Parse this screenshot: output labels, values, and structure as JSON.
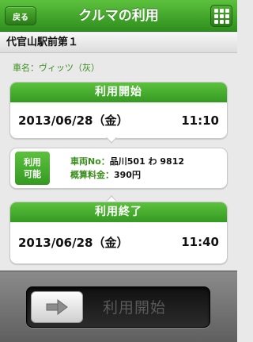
{
  "header": {
    "back_label": "戻る",
    "title": "クルマの利用"
  },
  "station": {
    "name": "代官山駅前第１"
  },
  "car": {
    "label": "車名：",
    "value": "ヴィッツ（灰）"
  },
  "start": {
    "heading": "利用開始",
    "date": "2013/06/28（金）",
    "time": "11:10"
  },
  "status": {
    "badge_line1": "利用",
    "badge_line2": "可能",
    "vehicle_key": "車両No：",
    "vehicle_value": "品川501 わ 9812",
    "fee_key": "概算料金：",
    "fee_value": "390円"
  },
  "end": {
    "heading": "利用終了",
    "date": "2013/06/28（金）",
    "time": "11:40"
  },
  "slider": {
    "label": "利用開始"
  },
  "colors": {
    "accent": "#3a9e22",
    "header_bg": "#2f8f1d"
  }
}
